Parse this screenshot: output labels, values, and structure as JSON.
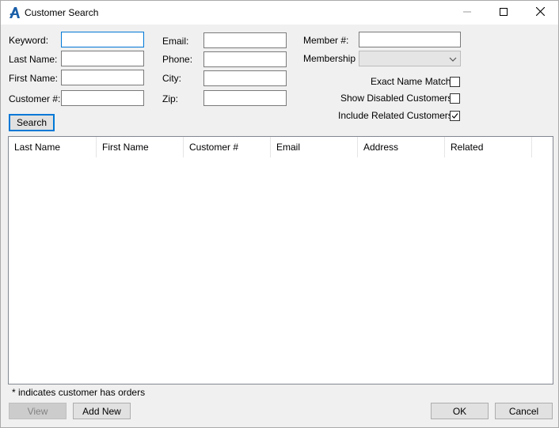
{
  "window": {
    "title": "Customer Search",
    "icon": "app-logo-icon",
    "controls": [
      "minimize-icon",
      "maximize-icon",
      "close-icon"
    ]
  },
  "form": {
    "keyword_label": "Keyword:",
    "last_name_label": "Last Name:",
    "first_name_label": "First Name:",
    "customer_num_label": "Customer #:",
    "email_label": "Email:",
    "phone_label": "Phone:",
    "city_label": "City:",
    "zip_label": "Zip:",
    "member_num_label": "Member #:",
    "membership_label": "Membership",
    "keyword_value": "",
    "last_name_value": "",
    "first_name_value": "",
    "customer_num_value": "",
    "email_value": "",
    "phone_value": "",
    "city_value": "",
    "zip_value": "",
    "member_num_value": "",
    "membership_value": ""
  },
  "options": {
    "exact_name_match": {
      "label": "Exact Name Match",
      "checked": false
    },
    "show_disabled": {
      "label": "Show Disabled Customers",
      "checked": false
    },
    "include_related": {
      "label": "Include Related Customers",
      "checked": true
    }
  },
  "search_button": "Search",
  "results": {
    "columns": [
      "Last Name",
      "First Name",
      "Customer #",
      "Email",
      "Address",
      "Related"
    ],
    "rows": []
  },
  "footnote": "* indicates customer has orders",
  "buttons": {
    "view": "View",
    "add_new": "Add New",
    "ok": "OK",
    "cancel": "Cancel"
  },
  "colors": {
    "accent": "#0078d7",
    "logo": "#1b5fa8"
  }
}
